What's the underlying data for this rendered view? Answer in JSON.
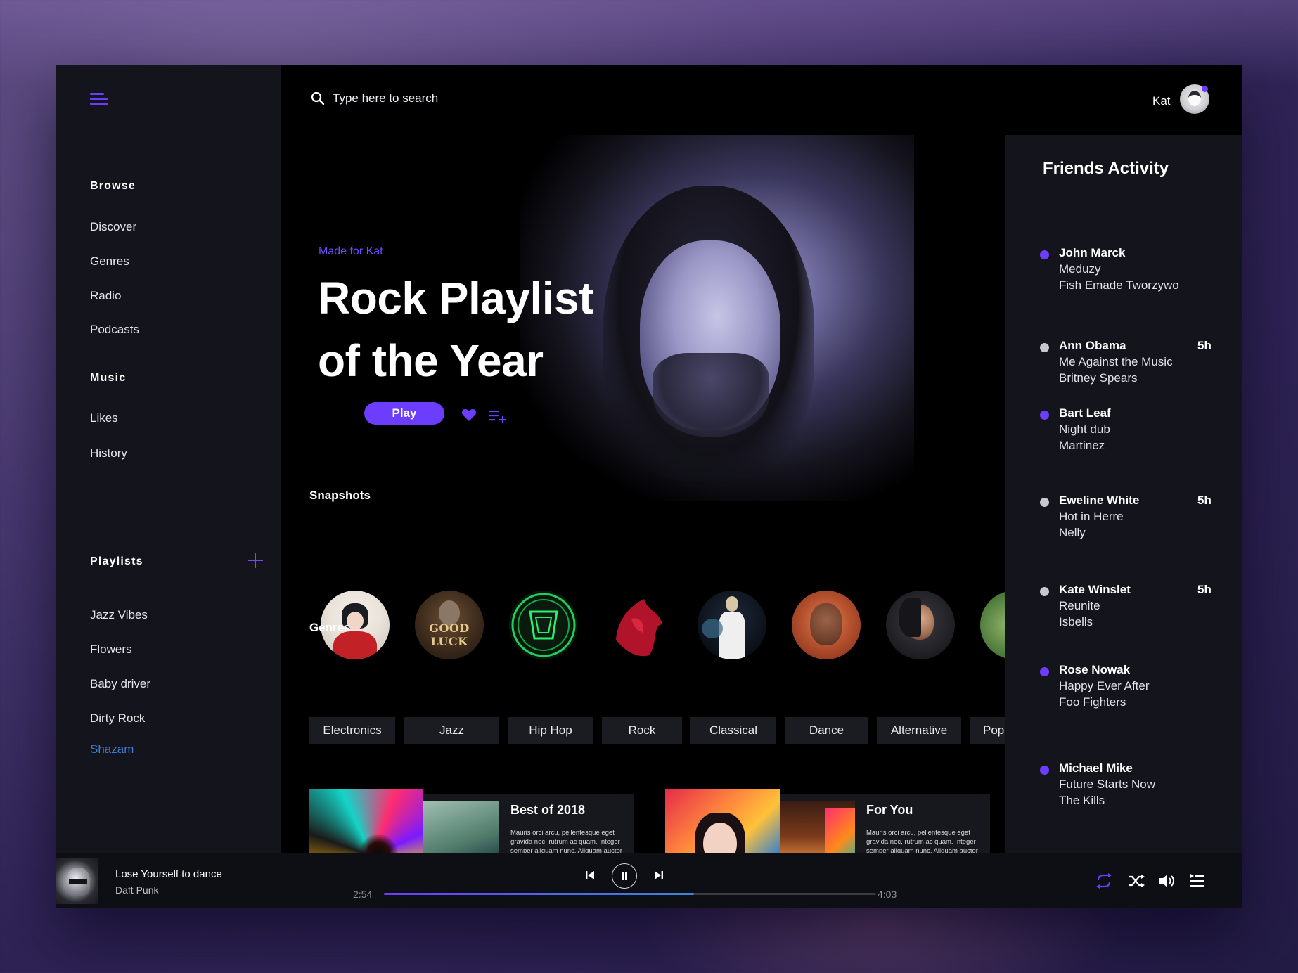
{
  "colors": {
    "accent": "#6c3cff",
    "active_link": "#3a7bd5",
    "online": "#6c3cff",
    "offline": "#c8c8cc"
  },
  "search": {
    "placeholder": "Type here to search"
  },
  "user": {
    "name": "Kat"
  },
  "sidebar": {
    "browse_heading": "Browse",
    "browse_items": [
      "Discover",
      "Genres",
      "Radio",
      "Podcasts"
    ],
    "music_heading": "Music",
    "music_items": [
      "Likes",
      "History"
    ],
    "playlists_heading": "Playlists",
    "playlists": [
      "Jazz Vibes",
      "Flowers",
      "Baby driver",
      "Dirty Rock",
      "Shazam"
    ],
    "active_playlist": "Shazam"
  },
  "hero": {
    "eyebrow": "Made for Kat",
    "title": "Rock Playlist of the Year",
    "play_label": "Play"
  },
  "snapshots": {
    "title": "Snapshots",
    "count": 8,
    "labels": [
      "",
      "GOOD LUCK",
      "",
      "",
      "",
      "",
      "",
      ""
    ]
  },
  "genres": {
    "title": "Genres",
    "items": [
      "Electronics",
      "Jazz",
      "Hip Hop",
      "Rock",
      "Classical",
      "Dance",
      "Alternative",
      "Pop"
    ]
  },
  "cards": [
    {
      "title": "Best of 2018",
      "desc": "Mauris orci arcu, pellentesque eget gravida nec, rutrum ac quam. Integer semper aliquam nunc. Aliquam auctor faucibus velit nec fringilla. Aliquam nisl mauris, aliquet id porttitor sed, rhoncus eu justo."
    },
    {
      "title": "For You",
      "desc": "Mauris orci arcu, pellentesque eget gravida nec, rutrum ac quam. Integer semper aliquam nunc. Aliquam auctor faucibus velit nec fringilla. Aliquam nisl mauris, aliquet id porttitor sed, rhoncus eu justo."
    }
  ],
  "friends": {
    "title": "Friends Activity",
    "items": [
      {
        "name": "John Marck",
        "track": "Meduzy",
        "artist": "Fish Emade Tworzywo",
        "time": "",
        "online": true
      },
      {
        "name": "Ann Obama",
        "track": "Me Against the Music",
        "artist": "Britney Spears",
        "time": "5h",
        "online": false
      },
      {
        "name": "Bart Leaf",
        "track": "Night dub",
        "artist": "Martinez",
        "time": "",
        "online": true
      },
      {
        "name": "Eweline White",
        "track": "Hot in Herre",
        "artist": "Nelly",
        "time": "5h",
        "online": false
      },
      {
        "name": "Kate Winslet",
        "track": "Reunite",
        "artist": "Isbells",
        "time": "5h",
        "online": false
      },
      {
        "name": "Rose Nowak",
        "track": "Happy Ever After",
        "artist": "Foo Fighters",
        "time": "",
        "online": true
      },
      {
        "name": "Michael Mike",
        "track": "Future Starts Now",
        "artist": "The Kills",
        "time": "",
        "online": true
      }
    ]
  },
  "player": {
    "track": "Lose Yourself to dance",
    "artist": "Daft Punk",
    "current_time": "2:54",
    "total_time": "4:03",
    "progress": 0.63
  }
}
